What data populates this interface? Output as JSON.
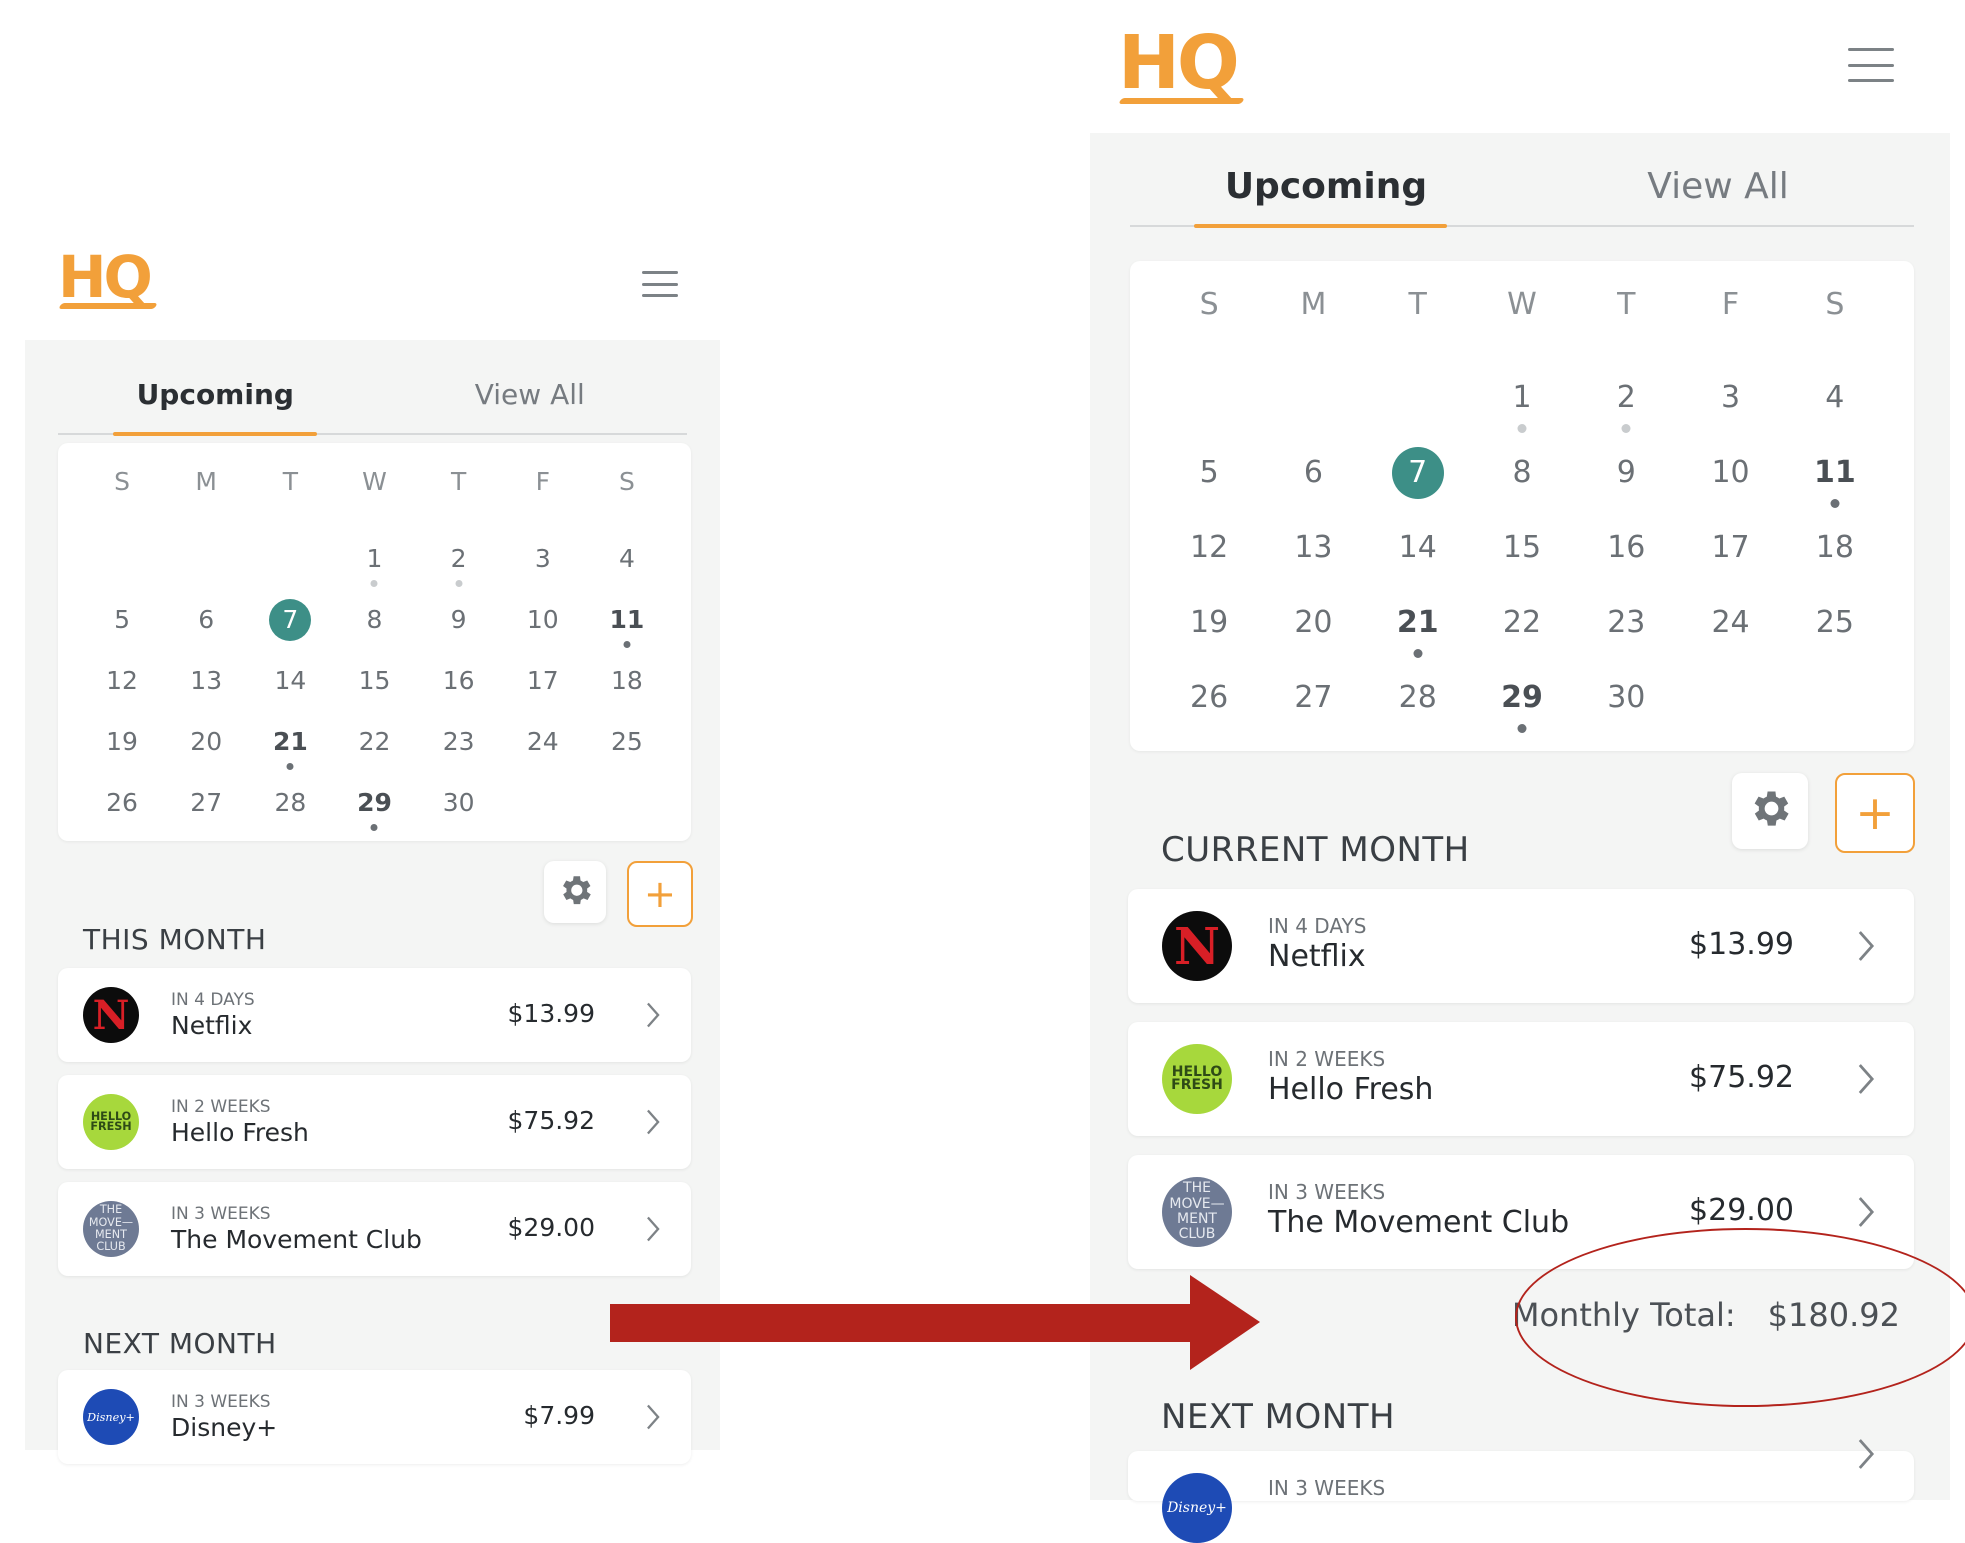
{
  "app": {
    "logo_text": "HQ",
    "brand_color": "#f2a03a",
    "today_color": "#3d8f87",
    "annotation_color": "#b3231c"
  },
  "tabs": [
    {
      "label": "Upcoming"
    },
    {
      "label": "View All"
    }
  ],
  "calendar": {
    "weekdays": [
      "S",
      "M",
      "T",
      "W",
      "T",
      "F",
      "S"
    ],
    "days": [
      [
        "",
        "",
        "",
        "1",
        "2",
        "3",
        "4"
      ],
      [
        "5",
        "6",
        "7",
        "8",
        "9",
        "10",
        "11"
      ],
      [
        "12",
        "13",
        "14",
        "15",
        "16",
        "17",
        "18"
      ],
      [
        "19",
        "20",
        "21",
        "22",
        "23",
        "24",
        "25"
      ],
      [
        "26",
        "27",
        "28",
        "29",
        "30",
        "",
        ""
      ]
    ],
    "today": "7",
    "light_dot_days": [
      "1",
      "2"
    ],
    "dark_dot_days": [
      "11",
      "21",
      "29"
    ]
  },
  "icons": {
    "menu": "hamburger-menu-icon",
    "settings": "gear-icon",
    "add": "plus-icon",
    "chevron": "chevron-right-icon",
    "arrow": "right-arrow-icon"
  },
  "icon_labels": {
    "netflix": "N",
    "hellofresh": "HELLO FRESH",
    "movement": "THE MOVE—MENT CLUB",
    "disney": "Disney+"
  },
  "screen_before": {
    "this_month_title": "THIS MONTH",
    "next_month_title": "NEXT MONTH",
    "subscriptions": [
      {
        "icon": "netflix",
        "when": "IN 4 DAYS",
        "name": "Netflix",
        "amount": "$13.99"
      },
      {
        "icon": "hellofresh",
        "when": "IN 2 WEEKS",
        "name": "Hello Fresh",
        "amount": "$75.92"
      },
      {
        "icon": "movement",
        "when": "IN 3 WEEKS",
        "name": "The Movement Club",
        "amount": "$29.00"
      }
    ],
    "next_subscriptions": [
      {
        "icon": "disney",
        "when": "IN 3 WEEKS",
        "name": "Disney+",
        "amount": "$7.99"
      }
    ]
  },
  "screen_after": {
    "this_month_title": "CURRENT MONTH",
    "next_month_title": "NEXT MONTH",
    "subscriptions": [
      {
        "icon": "netflix",
        "when": "IN 4 DAYS",
        "name": "Netflix",
        "amount": "$13.99"
      },
      {
        "icon": "hellofresh",
        "when": "IN 2 WEEKS",
        "name": "Hello Fresh",
        "amount": "$75.92"
      },
      {
        "icon": "movement",
        "when": "IN 3 WEEKS",
        "name": "The Movement Club",
        "amount": "$29.00"
      }
    ],
    "monthly_total_label": "Monthly Total:",
    "monthly_total_value": "$180.92",
    "next_subscriptions": [
      {
        "icon": "disney",
        "when": "IN 3 WEEKS",
        "name": "",
        "amount": ""
      }
    ]
  }
}
